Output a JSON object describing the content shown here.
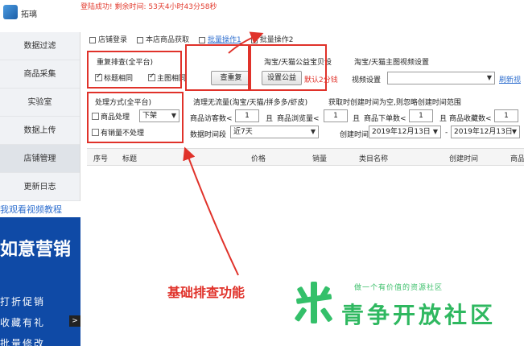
{
  "app": {
    "name": "拓璃",
    "status_message": "登陆成功! 剩余时间: 53天4小时43分58秒"
  },
  "sidebar": {
    "items": [
      {
        "label": "数据过滤"
      },
      {
        "label": "商品采集"
      },
      {
        "label": "实验室"
      },
      {
        "label": "数据上传"
      },
      {
        "label": "店铺管理",
        "active": true
      },
      {
        "label": "更新日志"
      }
    ],
    "video_link": "我观看视频教程",
    "promo": {
      "title": "如意营销",
      "lines": [
        "打折促销",
        "收藏有礼",
        "批量修改"
      ]
    }
  },
  "tabs": [
    {
      "label": "店铺登录"
    },
    {
      "label": "本店商品获取"
    },
    {
      "label": "批量操作1",
      "active": true
    },
    {
      "label": "批量操作2"
    }
  ],
  "dedupe": {
    "title": "重复排查(全平台)",
    "option_title_same": "标题相同",
    "option_main_image_same": "主图相同",
    "button": "查重复"
  },
  "welfare": {
    "title": "淘宝/天猫公益宝贝设",
    "button": "设置公益",
    "default_text": "默认2分钱"
  },
  "video": {
    "title": "淘宝/天猫主图视频设置",
    "label": "视频设置",
    "select_value": "",
    "refresh_link": "刷新视"
  },
  "processing": {
    "title": "处理方式(全平台)",
    "option_process_goods": "商品处理",
    "select_value": "下架",
    "option_no_sales": "有销量不处理"
  },
  "cleanup": {
    "title": "清理无流量(淘宝/天猫/拼多多/虾皮)",
    "visitors_label": "商品访客数<",
    "visitors_value": "1",
    "and1": "且",
    "views_label": "商品浏览量<",
    "views_value": "1",
    "range_label": "数据时间段",
    "range_value": "近7天"
  },
  "creation": {
    "title": "获取时创建时间为空,则忽略创建时间范围",
    "and2": "且",
    "orders_label": "商品下单数<",
    "orders_value": "1",
    "and3": "且",
    "fav_label": "商品收藏数<",
    "fav_value": "1",
    "time_label": "创建时间",
    "start_date": "2019年12月13日",
    "dash": "-",
    "end_date": "2019年12月13日"
  },
  "table": {
    "columns": [
      "序号",
      "标题",
      "价格",
      "销量",
      "类目名称",
      "创建时间",
      "商品"
    ]
  },
  "annotation": {
    "text": "基础排查功能"
  },
  "watermark": {
    "tagline": "做一个有价值的资源社区",
    "name": "青争开放社区"
  },
  "colors": {
    "accent_red": "#e0322a",
    "link_blue": "#2f6fcf",
    "promo_blue": "#0f4aa6",
    "watermark_green": "#2fb860"
  }
}
